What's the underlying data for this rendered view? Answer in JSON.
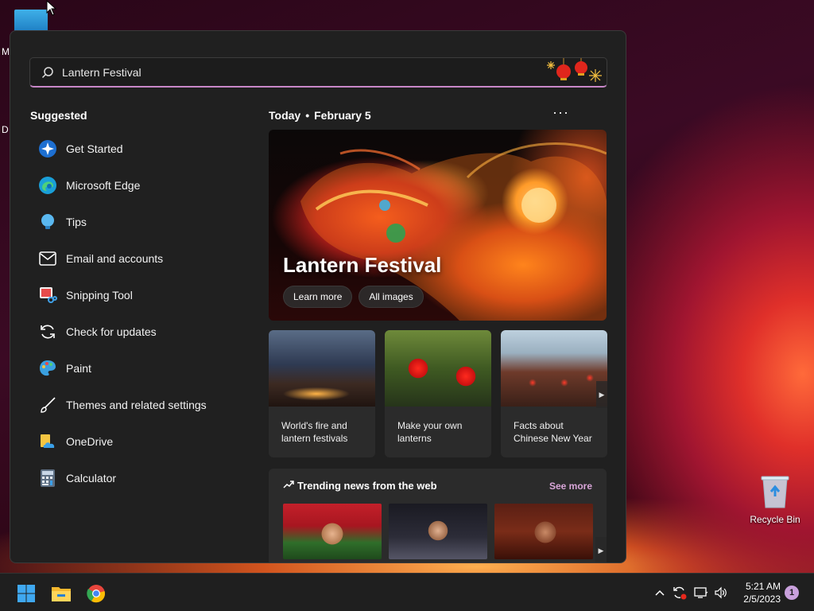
{
  "desktop": {
    "left_text_1": "M",
    "left_text_2": "D",
    "recycle_bin_label": "Recycle Bin"
  },
  "search": {
    "value": "Lantern Festival"
  },
  "suggested": {
    "title": "Suggested",
    "items": [
      {
        "label": "Get Started",
        "icon": "get-started-icon"
      },
      {
        "label": "Microsoft Edge",
        "icon": "edge-icon"
      },
      {
        "label": "Tips",
        "icon": "tips-icon"
      },
      {
        "label": "Email and accounts",
        "icon": "mail-icon"
      },
      {
        "label": "Snipping Tool",
        "icon": "snipping-tool-icon"
      },
      {
        "label": "Check for updates",
        "icon": "refresh-icon"
      },
      {
        "label": "Paint",
        "icon": "paint-icon"
      },
      {
        "label": "Themes and related settings",
        "icon": "brush-icon"
      },
      {
        "label": "OneDrive",
        "icon": "onedrive-icon"
      },
      {
        "label": "Calculator",
        "icon": "calculator-icon"
      }
    ]
  },
  "today": {
    "label": "Today",
    "separator": "•",
    "date": "February 5",
    "more": "···"
  },
  "hero": {
    "title": "Lantern Festival",
    "learn_more": "Learn more",
    "all_images": "All images"
  },
  "cards": [
    {
      "text": "World's fire and lantern festivals"
    },
    {
      "text": "Make your own lanterns"
    },
    {
      "text": "Facts about Chinese New Year"
    }
  ],
  "trending": {
    "title": "Trending news from the web",
    "see_more": "See more"
  },
  "clock": {
    "time": "5:21 AM",
    "date": "2/5/2023"
  },
  "notifications": {
    "count": "1"
  },
  "colors": {
    "accent": "#c887c8",
    "panel": "#202020",
    "card": "#2b2b2b"
  }
}
